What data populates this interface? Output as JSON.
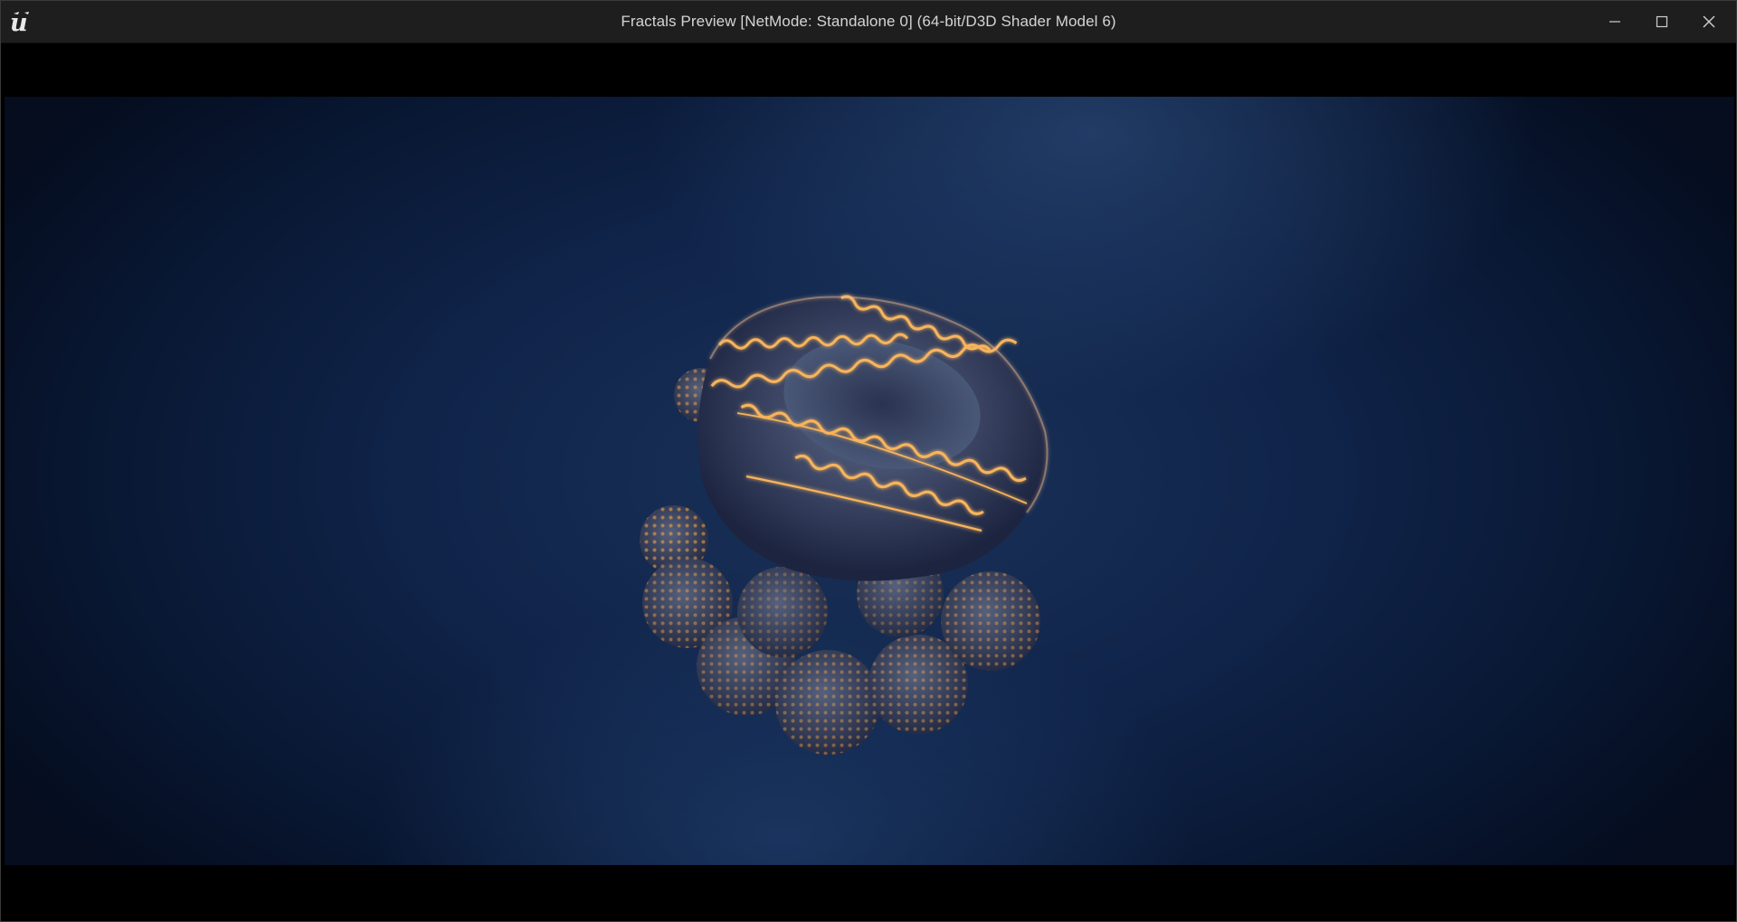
{
  "window": {
    "title": "Fractals Preview [NetMode: Standalone 0]  (64-bit/D3D Shader Model 6)",
    "app_icon": "unreal-engine-logo",
    "controls": {
      "minimize_icon": "minimize-icon",
      "maximize_icon": "maximize-icon",
      "close_icon": "close-icon"
    }
  },
  "viewport": {
    "content": "fractal-render",
    "colors": {
      "background_dark": "#081630",
      "background_mid": "#1a3258",
      "glow_orange": "#f5a84a",
      "surface_blue": "#4a5a7a"
    }
  }
}
